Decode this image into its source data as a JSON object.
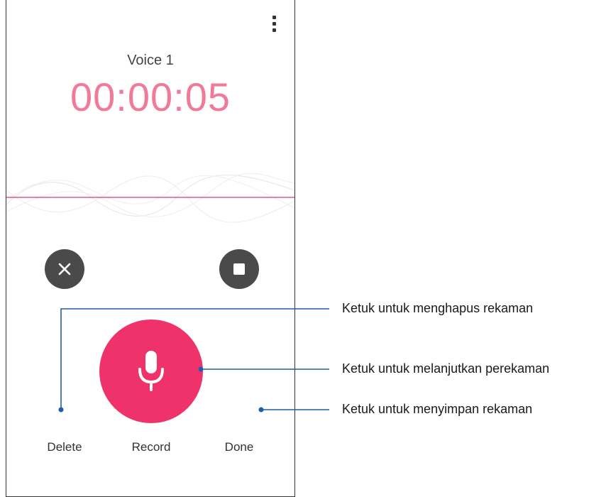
{
  "app": {
    "recording_name": "Voice 1",
    "timer": "00:00:05",
    "accent_color": "#f0326a",
    "timer_color": "#f27a98",
    "menu_icon": "more-vertical-icon"
  },
  "controls": {
    "delete": {
      "label": "Delete",
      "icon": "close-icon"
    },
    "record": {
      "label": "Record",
      "icon": "microphone-icon"
    },
    "done": {
      "label": "Done",
      "icon": "stop-icon"
    }
  },
  "callouts": {
    "delete": "Ketuk untuk menghapus rekaman",
    "record": "Ketuk untuk melanjutkan perekaman",
    "done": "Ketuk untuk menyimpan rekaman"
  }
}
